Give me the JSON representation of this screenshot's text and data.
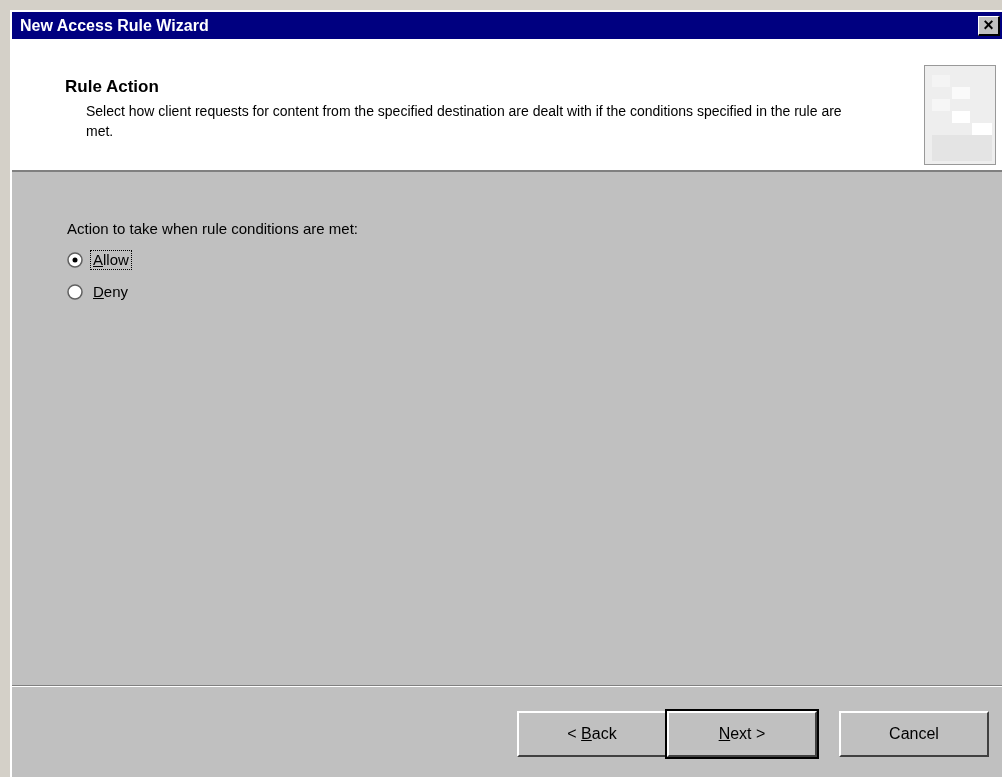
{
  "window": {
    "title": "New Access Rule Wizard",
    "close_glyph": "×"
  },
  "header": {
    "title": "Rule Action",
    "description": "Select how client requests for content from the specified destination are dealt with if the conditions specified in the rule are met."
  },
  "prompt": "Action to take when rule conditions are met:",
  "options": [
    {
      "key": "A",
      "post": "llow",
      "selected": true
    },
    {
      "key": "D",
      "post": "eny",
      "selected": false
    }
  ],
  "buttons": [
    {
      "pre": "< ",
      "key": "B",
      "post": "ack",
      "default": false
    },
    {
      "key": "N",
      "post": "ext >",
      "default": true
    },
    {
      "pre": "Cancel",
      "default": false
    }
  ]
}
